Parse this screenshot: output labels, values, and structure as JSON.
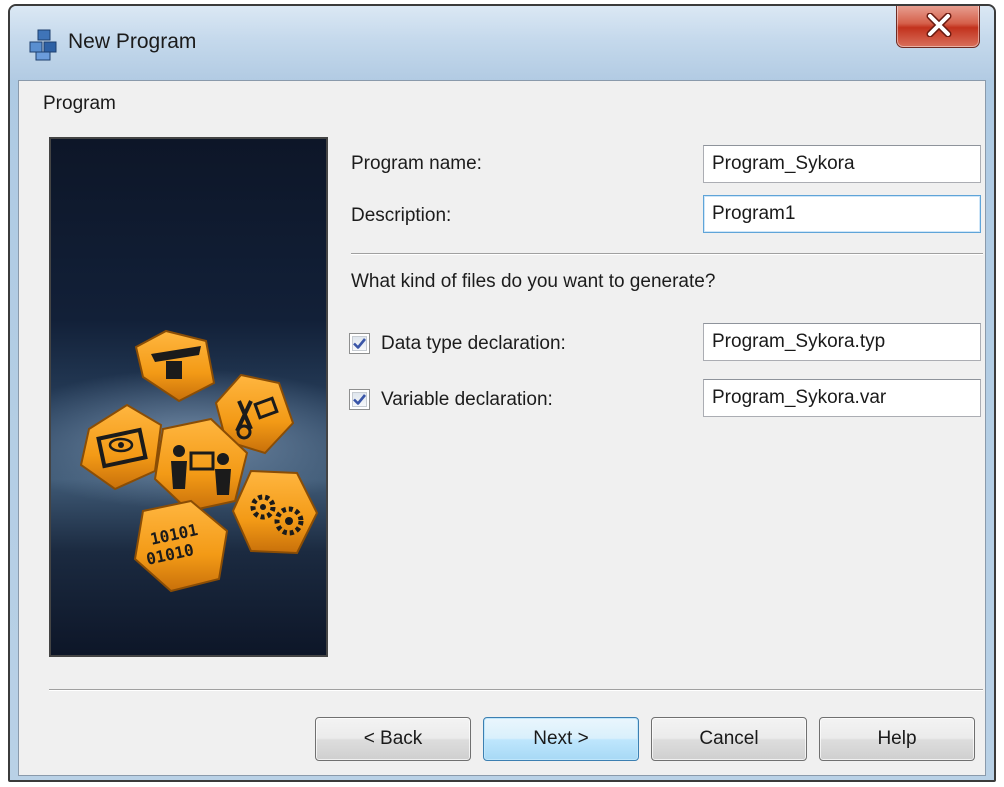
{
  "window": {
    "title": "New Program"
  },
  "section": {
    "title": "Program"
  },
  "form": {
    "program_name_label": "Program name:",
    "program_name_value": "Program_Sykora",
    "description_label": "Description:",
    "description_value": "Program1",
    "question": "What kind of files do you want to generate?",
    "data_type_label": "Data type declaration:",
    "data_type_checked": true,
    "data_type_file": "Program_Sykora.typ",
    "variable_label": "Variable declaration:",
    "variable_checked": true,
    "variable_file": "Program_Sykora.var"
  },
  "buttons": {
    "back": "< Back",
    "next": "Next >",
    "cancel": "Cancel",
    "help": "Help"
  },
  "banner": {
    "binary_line1": "10101",
    "binary_line2": "01010"
  },
  "colors": {
    "hex_orange": "#f39a16",
    "accent": "#3c7fb1",
    "close_red": "#c2321d"
  }
}
